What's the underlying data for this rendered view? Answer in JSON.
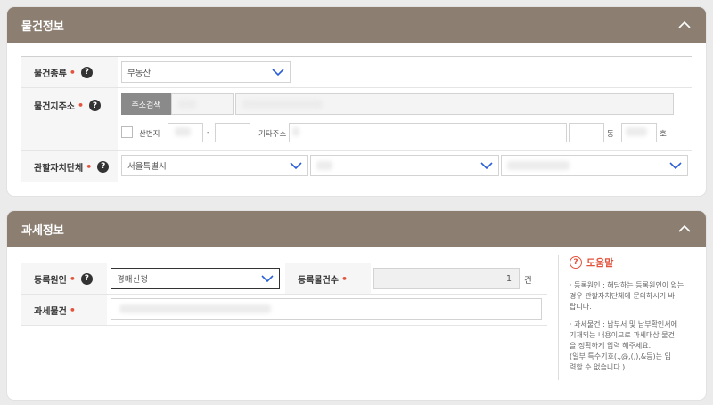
{
  "property_section": {
    "title": "물건정보",
    "type_label": "물건종류",
    "type_value": "부동산",
    "address_label": "물건지주소",
    "address_search_button": "주소검색",
    "sanbeonji_label": "산번지",
    "dash": "-",
    "other_address_label": "기타주소",
    "dong_label": "동",
    "ho_label": "호",
    "jurisdiction_label": "관할자치단체",
    "jurisdiction_value": "서울특별시"
  },
  "tax_section": {
    "title": "과세정보",
    "reason_label": "등록원인",
    "reason_value": "경매신청",
    "count_label": "등록물건수",
    "count_value": "1",
    "count_unit": "건",
    "item_label": "과세물건",
    "help_title": "도움말",
    "help_items": [
      "· 등록원인 : 해당하는 등록원인이 없는\n  경우 관할자치단체에 문의하시기 바\n  랍니다.",
      "· 과세물건 : 납부서 및 납부확인서에\n  기재되는 내용이므로 과세대상 물건\n  을 정확하게 입력 해주세요.\n  (일부 특수기호(.,@,(,),&등)는 입\n  력할 수 없습니다.)"
    ]
  },
  "colors": {
    "header_bg": "#8c7f72",
    "required": "#e2543e",
    "select_arrow": "#2b5fd9"
  }
}
